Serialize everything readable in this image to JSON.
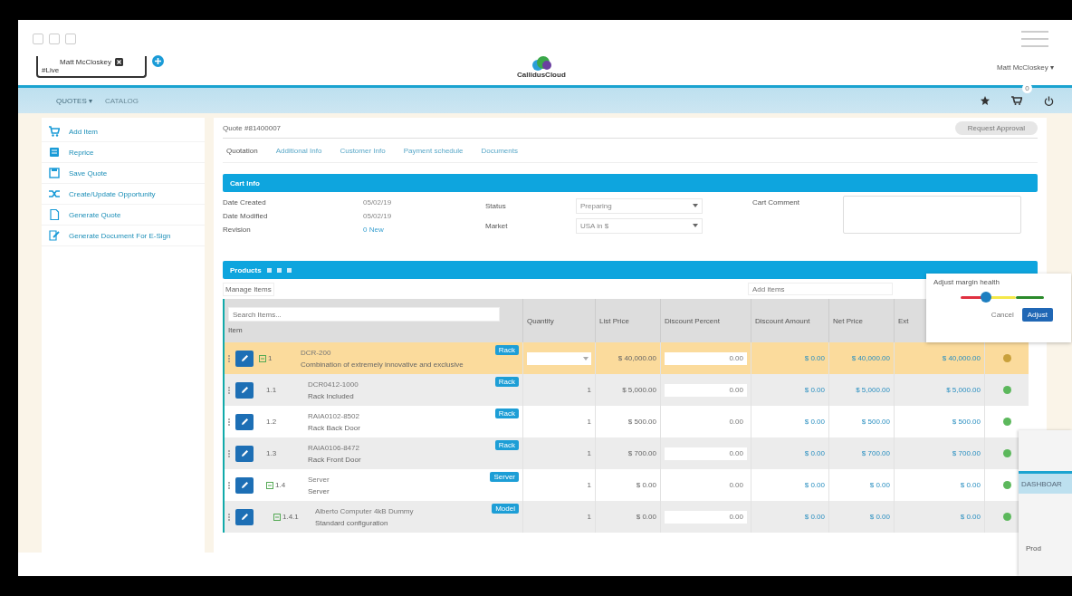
{
  "browser_tab": {
    "title": "Matt McCloskey",
    "subtitle": "#Live"
  },
  "logo": {
    "text": "CallidusCloud"
  },
  "user_menu": {
    "label": "Matt McCloskey ▾"
  },
  "nav": [
    {
      "label": "QUOTES ▾",
      "selected": true
    },
    {
      "label": "CATALOG",
      "selected": false
    }
  ],
  "cart_badge": "0",
  "sidebar": {
    "items": [
      {
        "label": "Add Item"
      },
      {
        "label": "Reprice"
      },
      {
        "label": "Save Quote"
      },
      {
        "label": "Create/Update Opportunity"
      },
      {
        "label": "Generate Quote"
      },
      {
        "label": "Generate Document For E-Sign"
      }
    ]
  },
  "quote": {
    "title": "Quote #81400007",
    "action": "Request Approval"
  },
  "tabs": [
    {
      "label": "Quotation",
      "selected": true
    },
    {
      "label": "Additional Info",
      "selected": false
    },
    {
      "label": "Customer Info",
      "selected": false
    },
    {
      "label": "Payment schedule",
      "selected": false
    },
    {
      "label": "Documents",
      "selected": false
    }
  ],
  "cart_info": {
    "title": "Cart Info",
    "fields": [
      {
        "label": "Date Created",
        "value": "05/02/19"
      },
      {
        "label": "Date Modified",
        "value": "05/02/19"
      },
      {
        "label": "Revision",
        "value": "0 New"
      }
    ],
    "status": {
      "label": "Status",
      "value": "Preparing"
    },
    "market": {
      "label": "Market",
      "value": "USA in $"
    },
    "comment": {
      "label": "Cart Comment"
    }
  },
  "products": {
    "title": "Products",
    "manage": "Manage Items",
    "add_placeholder": "Add items",
    "search_placeholder": "Search Items...",
    "columns": [
      "Item",
      "Quantity",
      "List Price",
      "Discount Percent",
      "Discount Amount",
      "Net Price",
      "Ext"
    ],
    "rows": [
      {
        "num": "1",
        "expandable": true,
        "name": "DCR-200",
        "desc": "Combination of extremely innovative and exclusive",
        "tag": "Rack",
        "qty": "",
        "list": "$ 40,000.00",
        "disc_pct": "0.00",
        "disc_amt": "$ 0.00",
        "net": "$ 40,000.00",
        "ext": "$ 40,000.00",
        "selected": true,
        "color": "#c9a13b",
        "children": [
          {
            "num": "1.1",
            "expandable": false,
            "name": "DCR0412-1000",
            "desc": "Rack Included",
            "tag": "Rack",
            "qty": "1",
            "list": "$ 5,000.00",
            "disc_pct": "0.00",
            "disc_amt": "$ 0.00",
            "net": "$ 5,000.00",
            "ext": "$ 5,000.00",
            "selected": false,
            "color": "#5cb85c"
          },
          {
            "num": "1.2",
            "expandable": false,
            "name": "RAIA0102-8502",
            "desc": "Rack Back Door",
            "tag": "Rack",
            "qty": "1",
            "list": "$ 500.00",
            "disc_pct": "0.00",
            "disc_amt": "$ 0.00",
            "net": "$ 500.00",
            "ext": "$ 500.00",
            "selected": false,
            "color": "#5cb85c"
          },
          {
            "num": "1.3",
            "expandable": false,
            "name": "RAIA0106-8472",
            "desc": "Rack Front Door",
            "tag": "Rack",
            "qty": "1",
            "list": "$ 700.00",
            "disc_pct": "0.00",
            "disc_amt": "$ 0.00",
            "net": "$ 700.00",
            "ext": "$ 700.00",
            "selected": false,
            "color": "#5cb85c"
          },
          {
            "num": "1.4",
            "expandable": true,
            "name": "Server",
            "desc": "Server",
            "tag": "Server",
            "qty": "1",
            "list": "$ 0.00",
            "disc_pct": "0.00",
            "disc_amt": "$ 0.00",
            "net": "$ 0.00",
            "ext": "$ 0.00",
            "selected": false,
            "color": "#5cb85c",
            "children": [
              {
                "num": "1.4.1",
                "expandable": true,
                "name": "Alberto Computer 4kB Dummy",
                "desc": "Standard configuration",
                "tag": "Model",
                "qty": "1",
                "list": "$ 0.00",
                "disc_pct": "0.00",
                "disc_amt": "$ 0.00",
                "net": "$ 0.00",
                "ext": "$ 0.00",
                "selected": false,
                "color": "#5cb85c"
              }
            ]
          }
        ]
      }
    ]
  },
  "margin_popup": {
    "title": "Adjust margin health",
    "level": 0.3,
    "cancel": "Cancel",
    "adjust": "Adjust"
  },
  "background_window": {
    "nav_label": "DASHBOAR",
    "text": "Prod"
  }
}
